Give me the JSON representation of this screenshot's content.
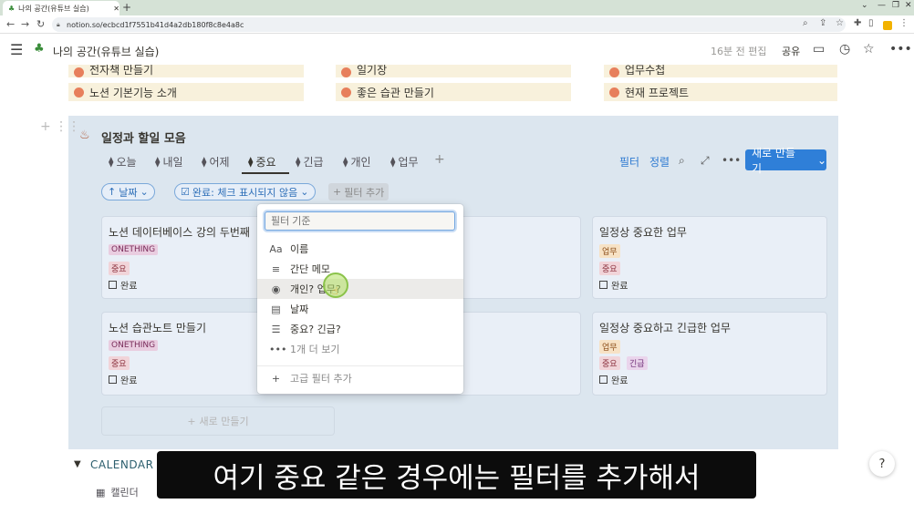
{
  "browser": {
    "tab_title": "나의 공간(유튜브 실습)",
    "url": "notion.so/ecbcd1f7551b41d4a2db180f8c8e4a8c"
  },
  "topbar": {
    "breadcrumb": "나의 공간(유튜브 실습)",
    "edited": "16분 전 편집",
    "share": "공유"
  },
  "top_cards": [
    {
      "label": "전자책 만들기"
    },
    {
      "label": "노션 기본기능 소개"
    },
    {
      "label": "일기장"
    },
    {
      "label": "좋은 습관 만들기"
    },
    {
      "label": "업무수첩"
    },
    {
      "label": "현재 프로젝트"
    }
  ],
  "database": {
    "title": "일정과 할일 모음",
    "tabs": [
      "오늘",
      "내일",
      "어제",
      "중요",
      "긴급",
      "개인",
      "업무"
    ],
    "active_tab": "중요",
    "filter_label": "필터",
    "sort_label": "정렬",
    "new_button": "새로 만들기",
    "sort_pill": "날짜",
    "filter_pill": "완료: 체크 표시되지 않음",
    "add_filter": "필터 추가",
    "cards": [
      {
        "title": "노션 데이터베이스 강의 두번째",
        "tags": [
          "ONETHING"
        ],
        "tags2": [
          "중요"
        ],
        "check": "완료"
      },
      {
        "title": "노션 습관노트 만들기",
        "tags": [
          "ONETHING"
        ],
        "tags2": [
          "중요"
        ],
        "check": "완료"
      },
      {
        "title": "일정상 중요한 업무",
        "tags": [
          "업무"
        ],
        "tags2": [
          "중요"
        ],
        "check": "완료"
      },
      {
        "title": "일정상 중요하고 긴급한 업무",
        "tags": [
          "업무"
        ],
        "tags2": [
          "중요",
          "긴급"
        ],
        "check": "완료"
      }
    ],
    "new_card": "새로 만들기"
  },
  "filter_menu": {
    "placeholder": "필터 기준",
    "options": [
      {
        "icon": "Aa",
        "label": "이름"
      },
      {
        "icon": "≡",
        "label": "간단 메모"
      },
      {
        "icon": "◉",
        "label": "개인? 업무?"
      },
      {
        "icon": "▤",
        "label": "날짜"
      },
      {
        "icon": "☰",
        "label": "중요? 긴급?"
      },
      {
        "icon": "•••",
        "label": "1개 더 보기"
      }
    ],
    "advanced": "고급 필터 추가"
  },
  "calendar": {
    "title": "CALENDAR",
    "view": "캘린더"
  },
  "subtitle": "여기 중요 같은 경우에는 필터를 추가해서",
  "help": "?"
}
